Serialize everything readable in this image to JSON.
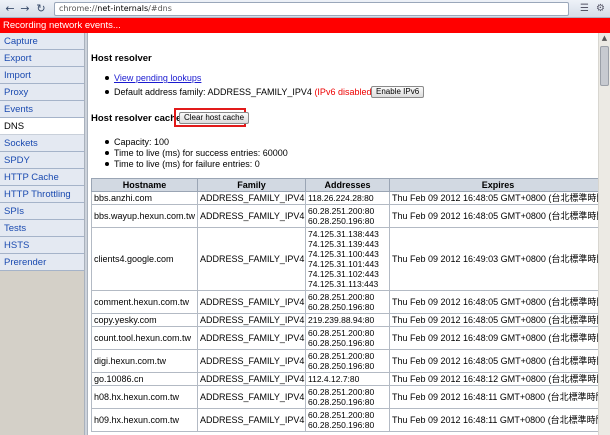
{
  "browser": {
    "url_scheme": "chrome://",
    "url_host": "net-internals",
    "url_path": "/#dns",
    "icons": {
      "back": "back-arrow-icon",
      "forward": "forward-arrow-icon",
      "reload": "reload-icon",
      "page": "page-icon",
      "wrench": "wrench-icon"
    }
  },
  "banner": {
    "text": "Recording network events..."
  },
  "sidebar": {
    "items": [
      {
        "label": "Capture"
      },
      {
        "label": "Export"
      },
      {
        "label": "Import"
      },
      {
        "label": "Proxy"
      },
      {
        "label": "Events"
      },
      {
        "label": "DNS",
        "selected": true
      },
      {
        "label": "Sockets"
      },
      {
        "label": "SPDY"
      },
      {
        "label": "HTTP Cache"
      },
      {
        "label": "HTTP Throttling"
      },
      {
        "label": "SPIs"
      },
      {
        "label": "Tests"
      },
      {
        "label": "HSTS"
      },
      {
        "label": "Prerender"
      }
    ]
  },
  "host_resolver": {
    "title": "Host resolver",
    "pending_link": "View pending lookups",
    "family_label": "Default address family: ADDRESS_FAMILY_IPV4",
    "ipv6_status": "(IPv6 disabled)",
    "enable_ipv6_button": "Enable IPv6"
  },
  "cache": {
    "title": "Host resolver cache",
    "clear_button": "Clear host cache",
    "capacity": "Capacity: 100",
    "ttl_success": "Time to live (ms) for success entries: 60000",
    "ttl_failure": "Time to live (ms) for failure entries: 0",
    "columns": [
      "Hostname",
      "Family",
      "Addresses",
      "Expires"
    ],
    "rows": [
      {
        "hostname": "bbs.anzhi.com",
        "family": "ADDRESS_FAMILY_IPV4",
        "addresses": [
          "118.26.224.28:80"
        ],
        "expires": "Thu Feb 09 2012 16:48:05 GMT+0800 (台北標準時間)"
      },
      {
        "hostname": "bbs.wayup.hexun.com.tw",
        "family": "ADDRESS_FAMILY_IPV4",
        "addresses": [
          "60.28.251.200:80",
          "60.28.250.196:80"
        ],
        "expires": "Thu Feb 09 2012 16:48:05 GMT+0800 (台北標準時間)"
      },
      {
        "hostname": "clients4.google.com",
        "family": "ADDRESS_FAMILY_IPV4",
        "addresses": [
          "74.125.31.138:443",
          "74.125.31.139:443",
          "74.125.31.100:443",
          "74.125.31.101:443",
          "74.125.31.102:443",
          "74.125.31.113:443"
        ],
        "expires": "Thu Feb 09 2012 16:49:03 GMT+0800 (台北標準時間)"
      },
      {
        "hostname": "comment.hexun.com.tw",
        "family": "ADDRESS_FAMILY_IPV4",
        "addresses": [
          "60.28.251.200:80",
          "60.28.250.196:80"
        ],
        "expires": "Thu Feb 09 2012 16:48:05 GMT+0800 (台北標準時間)"
      },
      {
        "hostname": "copy.yesky.com",
        "family": "ADDRESS_FAMILY_IPV4",
        "addresses": [
          "219.239.88.94:80"
        ],
        "expires": "Thu Feb 09 2012 16:48:05 GMT+0800 (台北標準時間)"
      },
      {
        "hostname": "count.tool.hexun.com.tw",
        "family": "ADDRESS_FAMILY_IPV4",
        "addresses": [
          "60.28.251.200:80",
          "60.28.250.196:80"
        ],
        "expires": "Thu Feb 09 2012 16:48:09 GMT+0800 (台北標準時間)"
      },
      {
        "hostname": "digi.hexun.com.tw",
        "family": "ADDRESS_FAMILY_IPV4",
        "addresses": [
          "60.28.251.200:80",
          "60.28.250.196:80"
        ],
        "expires": "Thu Feb 09 2012 16:48:05 GMT+0800 (台北標準時間)"
      },
      {
        "hostname": "go.10086.cn",
        "family": "ADDRESS_FAMILY_IPV4",
        "addresses": [
          "112.4.12.7:80"
        ],
        "expires": "Thu Feb 09 2012 16:48:12 GMT+0800 (台北標準時間)"
      },
      {
        "hostname": "h08.hx.hexun.com.tw",
        "family": "ADDRESS_FAMILY_IPV4",
        "addresses": [
          "60.28.251.200:80",
          "60.28.250.196:80"
        ],
        "expires": "Thu Feb 09 2012 16:48:11 GMT+0800 (台北標準時間)"
      },
      {
        "hostname": "h09.hx.hexun.com.tw",
        "family": "ADDRESS_FAMILY_IPV4",
        "addresses": [
          "60.28.251.200:80",
          "60.28.250.196:80"
        ],
        "expires": "Thu Feb 09 2012 16:48:11 GMT+0800 (台北標準時間)"
      }
    ]
  },
  "colors": {
    "banner": "#ff0000",
    "link": "#1a4ab0",
    "ipv6_disabled": "#ee0000",
    "highlight_box": "#e21a1a"
  }
}
